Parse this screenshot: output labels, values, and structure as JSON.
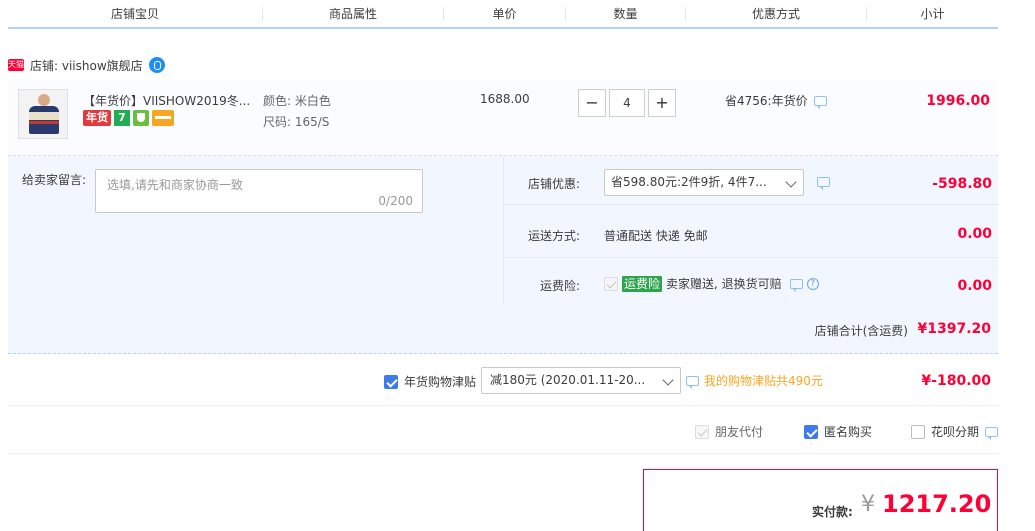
{
  "headers": [
    "店铺宝贝",
    "商品属性",
    "单价",
    "数量",
    "优惠方式",
    "小计"
  ],
  "shop": {
    "badge": "天猫",
    "label": "店铺: viishow旗舰店",
    "chat_icon": "wangwang-icon"
  },
  "item": {
    "title": "【年货价】VIISHOW2019冬...",
    "tags": [
      "年货",
      "7"
    ],
    "attr_color": "颜色: 米白色",
    "attr_size": "尺码: 165/S",
    "price": "1688.00",
    "quantity": "4",
    "minus": "−",
    "plus": "+",
    "discount": "省4756:年货价",
    "subtotal": "1996.00"
  },
  "message": {
    "label": "给卖家留言:",
    "placeholder": "选填,请先和商家协商一致",
    "count": "0/200"
  },
  "shop_discount": {
    "label": "店铺优惠:",
    "selected": "省598.80元:2件9折, 4件7...",
    "value": "-598.80"
  },
  "shipping": {
    "label": "运送方式:",
    "text": "普通配送 快递 免邮",
    "value": "0.00"
  },
  "insurance": {
    "label": "运费险:",
    "badge": "运费险",
    "text": "卖家赠送, 退换货可赔",
    "value": "0.00"
  },
  "shop_total": {
    "label": "店铺合计(含运费)",
    "value": "¥1397.20"
  },
  "allowance": {
    "label": "年货购物津贴",
    "selected": "减180元 (2020.01.11-20...",
    "link": "我的购物津贴共490元",
    "value": "¥-180.00"
  },
  "options": {
    "friend_pay": "朋友代付",
    "anonymous": "匿名购买",
    "huabei": "花呗分期"
  },
  "payment": {
    "label": "实付款:",
    "currency": "¥",
    "amount": "1217.20"
  },
  "colors": {
    "accent": "#ff0036",
    "blue": "#3e7be8",
    "panel": "#f2f7ff"
  }
}
